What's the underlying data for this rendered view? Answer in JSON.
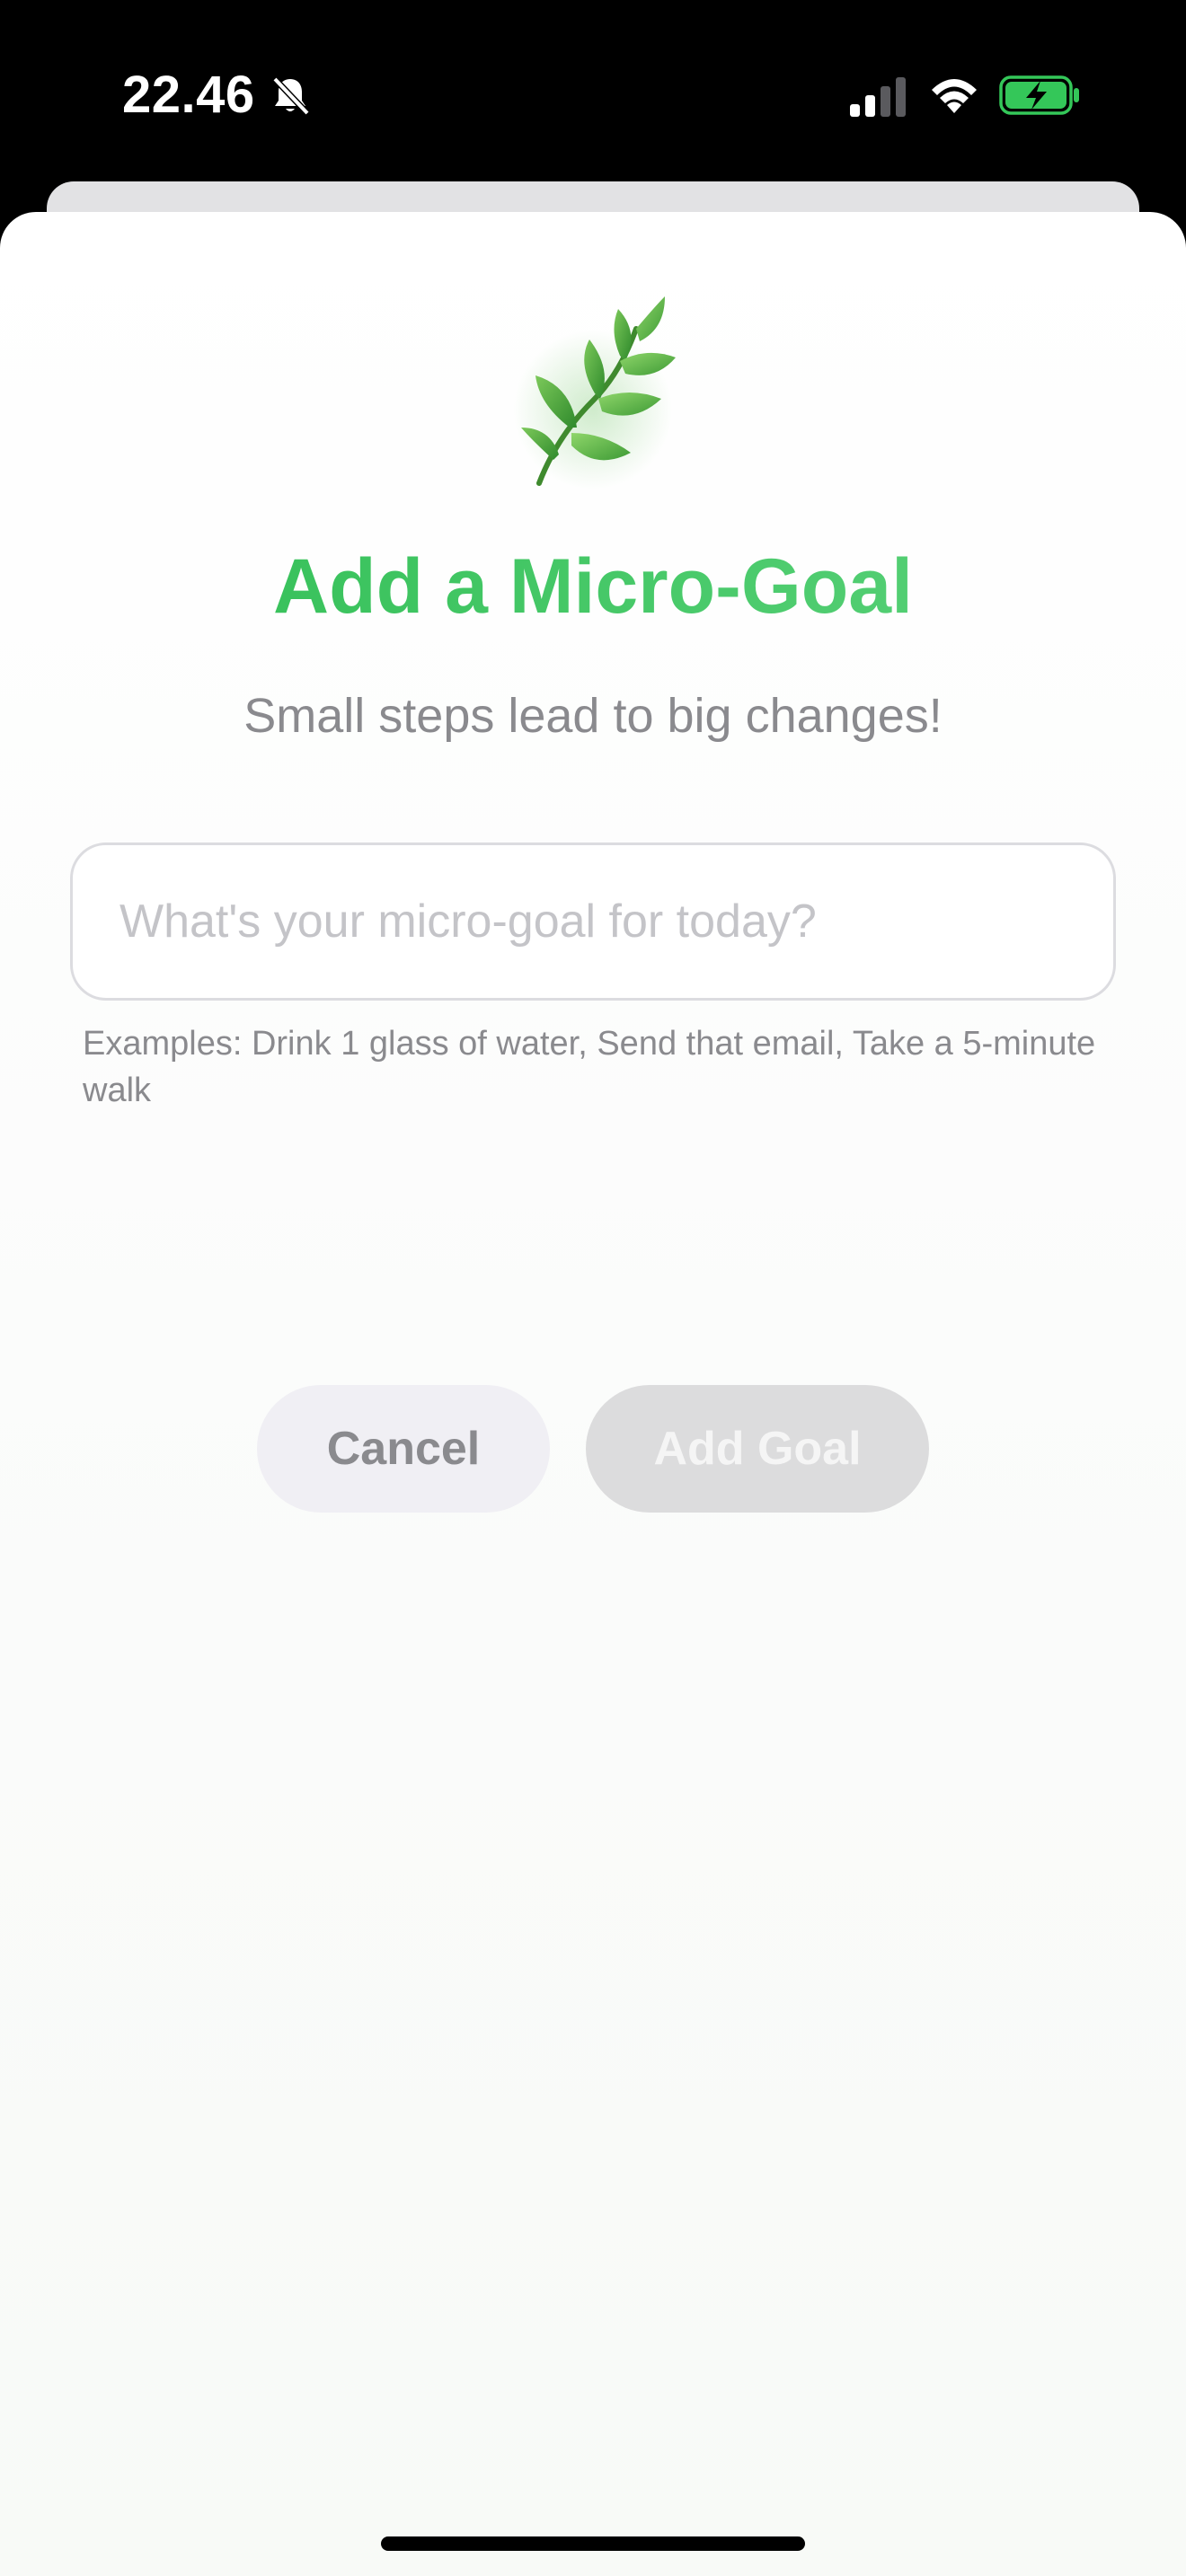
{
  "status_bar": {
    "time": "22.46",
    "icons": [
      "bell-slash-icon",
      "cellular-signal-icon",
      "wifi-icon",
      "battery-charging-icon"
    ]
  },
  "sheet": {
    "hero_icon": "herb-leaf-icon",
    "title": "Add a Micro-Goal",
    "subtitle": "Small steps lead to big changes!",
    "input": {
      "value": "",
      "placeholder": "What's your micro-goal for today?"
    },
    "examples_text": "Examples: Drink 1 glass of water, Send that email, Take a 5-minute walk",
    "buttons": {
      "cancel_label": "Cancel",
      "add_label": "Add Goal"
    }
  },
  "colors": {
    "title_gradient_start": "#2fbd53",
    "title_gradient_end": "#5dd37c",
    "battery_fill": "#34c759",
    "add_button_disabled_bg": "#dcdcdd",
    "cancel_button_bg": "#f0eff4"
  }
}
